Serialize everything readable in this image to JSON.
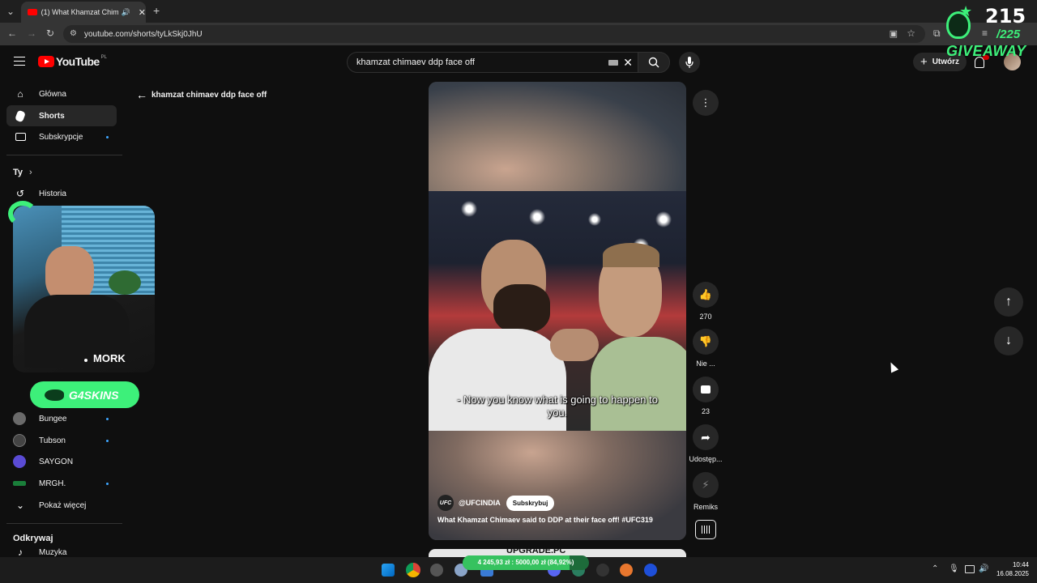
{
  "browser": {
    "tab_title": "(1) What Khamzat Chimaev",
    "url": "youtube.com/shorts/tyLkSkj0JhU"
  },
  "youtube": {
    "logo_text": "YouTube",
    "region": "PL",
    "search_value": "khamzat chimaev ddp face off",
    "create_label": "Utwórz",
    "back_title": "khamzat chimaev ddp face off"
  },
  "sidebar": {
    "items": [
      {
        "label": "Główna",
        "icon": "home-icon"
      },
      {
        "label": "Shorts",
        "icon": "shorts-icon"
      },
      {
        "label": "Subskrypcje",
        "icon": "subscriptions-icon"
      }
    ],
    "you_header": "Ty",
    "history": "Historia",
    "channels": [
      {
        "label": "Bungee",
        "color": "#6a6a6a"
      },
      {
        "label": "Tubson",
        "color": "#444444"
      },
      {
        "label": "SAYGON",
        "color": "#5a4bd4"
      },
      {
        "label": "MRGH.",
        "color": "#1a7f3a"
      }
    ],
    "show_more": "Pokaż więcej",
    "explore_header": "Odkrywaj",
    "explore_first": "Muzyka"
  },
  "overlay": {
    "streamer_name": "MORK",
    "sponsor_label": "G4SKINS",
    "giveaway_count": "215",
    "giveaway_total": "/225",
    "giveaway_label": "GIVEAWAY"
  },
  "short": {
    "subtitle": "- Now you know what is going to happen to you.",
    "channel_handle": "@UFCINDIA",
    "channel_avatar": "UFC",
    "subscribe_label": "Subskrybuj",
    "description": "What Khamzat Chimaev said to DDP at their face off! #UFC319",
    "next_preview": "UPGRADE.PC",
    "actions": {
      "likes": "270",
      "dislike": "Nie ...",
      "comments": "23",
      "share": "Udostęp...",
      "remix": "Remiks"
    }
  },
  "donation_bar": {
    "text": "4 245,93 zł : 5000,00 zł (84,92%)",
    "progress": 0.8492
  },
  "taskbar": {
    "time": "10:44",
    "date": "16.08.2025"
  },
  "colors": {
    "background": "#0f0f0f",
    "accent_red": "#ff0000",
    "overlay_green": "#3df07a",
    "link_blue": "#3ea6ff"
  }
}
